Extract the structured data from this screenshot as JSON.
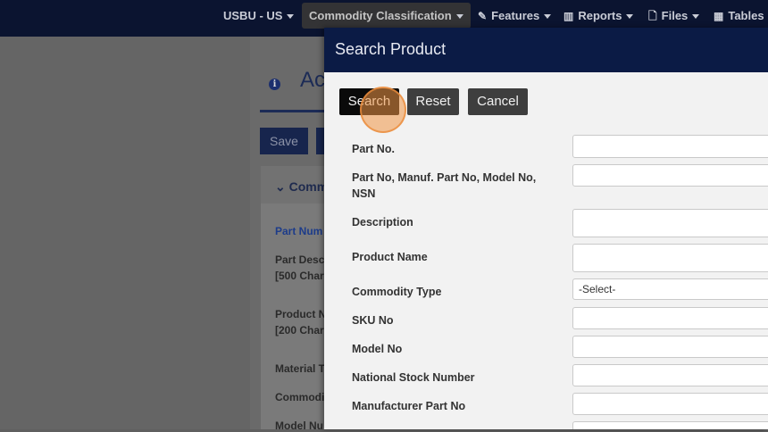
{
  "topnav": {
    "items": [
      {
        "label": "USBU - US"
      },
      {
        "label": "Commodity Classification"
      },
      {
        "label": "Features",
        "icon": "pencil-icon"
      },
      {
        "label": "Reports",
        "icon": "bar-chart-icon"
      },
      {
        "label": "Files",
        "icon": "file-icon"
      },
      {
        "label": "Tables",
        "icon": "table-icon"
      }
    ]
  },
  "background": {
    "title": "Ac",
    "save_label": "Save",
    "panel_heading": "Comm",
    "labels": [
      {
        "text": "Part Num"
      },
      {
        "text": "Part Desc"
      },
      {
        "text": "[500 Char"
      },
      {
        "text": "Product N"
      },
      {
        "text": "[200 Char"
      },
      {
        "text": "Material T"
      },
      {
        "text": "Commodi"
      },
      {
        "text": "Model Nu"
      }
    ]
  },
  "modal": {
    "title": "Search Product",
    "buttons": {
      "search": "Search",
      "reset": "Reset",
      "cancel": "Cancel"
    },
    "fields": [
      {
        "label": "Part No.",
        "value": ""
      },
      {
        "label": "Part No, Manuf. Part No, Model No, NSN",
        "value": ""
      },
      {
        "label": "Description",
        "value": ""
      },
      {
        "label": "Product Name",
        "value": ""
      },
      {
        "label": "Commodity Type",
        "value": "-Select-"
      },
      {
        "label": "SKU No",
        "value": ""
      },
      {
        "label": "Model No",
        "value": ""
      },
      {
        "label": "National Stock Number",
        "value": ""
      },
      {
        "label": "Manufacturer Part No",
        "value": ""
      }
    ]
  },
  "colors": {
    "nav_bg": "#0b1430",
    "modal_header": "#0b1b45",
    "accent": "#1c2b56"
  }
}
